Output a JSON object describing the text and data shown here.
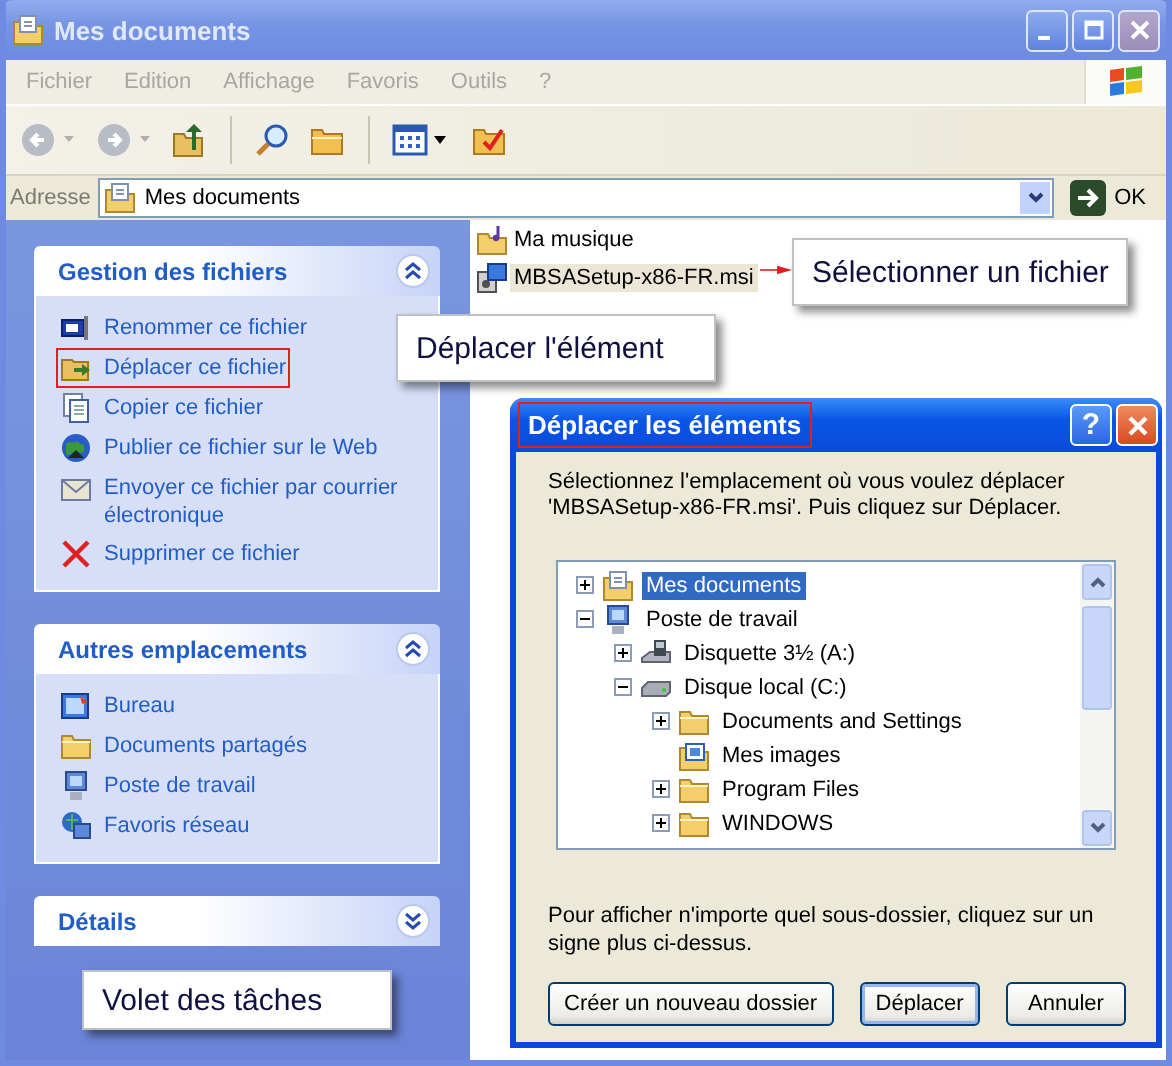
{
  "window": {
    "title": "Mes documents"
  },
  "menu": [
    "Fichier",
    "Edition",
    "Affichage",
    "Favoris",
    "Outils",
    "?"
  ],
  "address": {
    "label": "Adresse",
    "value": "Mes documents",
    "go": "OK"
  },
  "task_panes": [
    {
      "title": "Gestion des fichiers",
      "expanded": true,
      "items": [
        {
          "label": "Renommer ce fichier",
          "highlighted": false
        },
        {
          "label": "Déplacer ce fichier",
          "highlighted": true
        },
        {
          "label": "Copier ce fichier",
          "highlighted": false
        },
        {
          "label": "Publier ce fichier sur le Web",
          "highlighted": false
        },
        {
          "label": "Envoyer ce fichier par courrier électronique",
          "highlighted": false
        },
        {
          "label": "Supprimer ce fichier",
          "highlighted": false
        }
      ]
    },
    {
      "title": "Autres emplacements",
      "expanded": true,
      "items": [
        {
          "label": "Bureau",
          "highlighted": false
        },
        {
          "label": "Documents partagés",
          "highlighted": false
        },
        {
          "label": "Poste de travail",
          "highlighted": false
        },
        {
          "label": "Favoris réseau",
          "highlighted": false
        }
      ]
    },
    {
      "title": "Détails",
      "expanded": false
    }
  ],
  "files": [
    {
      "name": "Ma musique",
      "selected": false
    },
    {
      "name": "MBSASetup-x86-FR.msi",
      "selected": true
    }
  ],
  "callouts": [
    {
      "text": "Sélectionner un fichier",
      "kind": "file"
    },
    {
      "text": "Déplacer l'élément",
      "kind": "task"
    },
    {
      "text": "Volet des tâches",
      "kind": "pane"
    }
  ],
  "dialog": {
    "title": "Déplacer les éléments",
    "title_highlighted": true,
    "help": "?",
    "prompt": "Sélectionnez l'emplacement où vous voulez déplacer 'MBSASetup-x86-FR.msi'. Puis cliquez sur Déplacer.",
    "tree": [
      {
        "label": "Mes documents",
        "kind": "branch",
        "expanded": false,
        "selected": true
      },
      {
        "label": "Poste de travail",
        "kind": "branch",
        "expanded": true,
        "selected": false,
        "children": [
          {
            "label": "Disquette 3½ (A:)",
            "kind": "branch",
            "expanded": false,
            "selected": false
          },
          {
            "label": "Disque local (C:)",
            "kind": "branch",
            "expanded": true,
            "selected": false,
            "children": [
              {
                "label": "Documents and Settings",
                "kind": "branch",
                "expanded": false,
                "selected": false
              },
              {
                "label": "Mes images",
                "kind": "leaf",
                "selected": false
              },
              {
                "label": "Program Files",
                "kind": "branch",
                "expanded": false,
                "selected": false
              },
              {
                "label": "WINDOWS",
                "kind": "branch",
                "expanded": false,
                "selected": false
              }
            ]
          }
        ]
      }
    ],
    "hint": "Pour afficher n'importe quel sous-dossier, cliquez sur un signe plus ci-dessus.",
    "buttons": [
      {
        "label": "Créer un nouveau dossier",
        "default": false
      },
      {
        "label": "Déplacer",
        "default": true
      },
      {
        "label": "Annuler",
        "default": false
      }
    ]
  }
}
